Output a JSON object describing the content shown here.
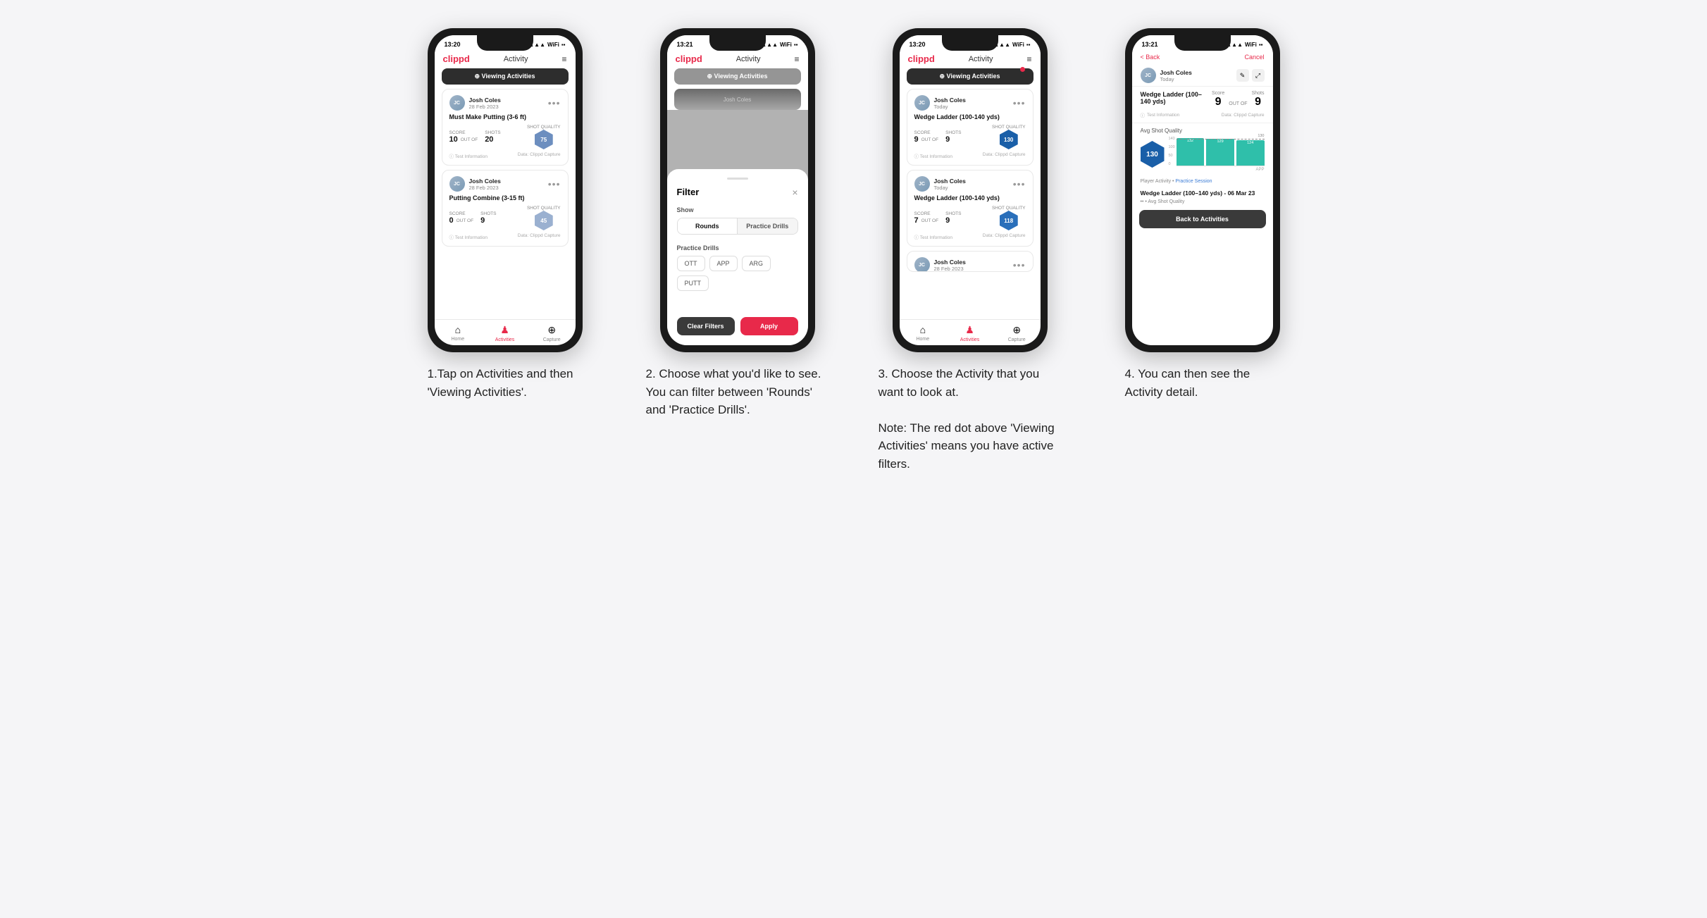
{
  "page": {
    "background": "#f5f5f7"
  },
  "steps": [
    {
      "id": "step1",
      "caption": "1.Tap on Activities and then 'Viewing Activities'.",
      "phone": {
        "statusBar": {
          "time": "13:20",
          "signal": "▲▲▲",
          "wifi": "WiFi",
          "battery": "■■"
        },
        "header": {
          "logo": "clippd",
          "title": "Activity",
          "menuIcon": "≡"
        },
        "viewingBar": {
          "label": "⊕  Viewing Activities",
          "hasRedDot": false
        },
        "cards": [
          {
            "userName": "Josh Coles",
            "userDate": "28 Feb 2023",
            "activityTitle": "Must Make Putting (3-6 ft)",
            "scoreLabel": "Score",
            "shotLabel": "Shots",
            "score": "10",
            "outOf": "OUT OF",
            "shots": "20",
            "qualityLabel": "Shot Quality",
            "quality": "75",
            "qualityClass": "quality-75",
            "footerLeft": "Test Information",
            "footerRight": "Data: Clippd Capture"
          },
          {
            "userName": "Josh Coles",
            "userDate": "28 Feb 2023",
            "activityTitle": "Putting Combine (3-15 ft)",
            "scoreLabel": "Score",
            "shotLabel": "Shots",
            "score": "0",
            "outOf": "OUT OF",
            "shots": "9",
            "qualityLabel": "Shot Quality",
            "quality": "45",
            "qualityClass": "quality-45",
            "footerLeft": "Test Information",
            "footerRight": "Data: Clippd Capture"
          }
        ]
      }
    },
    {
      "id": "step2",
      "caption": "2. Choose what you'd like to see. You can filter between 'Rounds' and 'Practice Drills'.",
      "phone": {
        "statusBar": {
          "time": "13:21",
          "signal": "▲▲▲",
          "wifi": "WiFi",
          "battery": "■■"
        },
        "header": {
          "logo": "clippd",
          "title": "Activity",
          "menuIcon": "≡"
        },
        "viewingBar": {
          "label": "⊕  Viewing Activities",
          "hasRedDot": false
        },
        "filter": {
          "title": "Filter",
          "showLabel": "Show",
          "toggleButtons": [
            {
              "label": "Rounds",
              "active": true
            },
            {
              "label": "Practice Drills",
              "active": false
            }
          ],
          "practiceLabel": "Practice Drills",
          "drillButtons": [
            "OTT",
            "APP",
            "ARG",
            "PUTT"
          ],
          "clearLabel": "Clear Filters",
          "applyLabel": "Apply"
        }
      }
    },
    {
      "id": "step3",
      "caption": "3. Choose the Activity that you want to look at.\n\nNote: The red dot above 'Viewing Activities' means you have active filters.",
      "captionLines": [
        "3. Choose the Activity that you want to look at.",
        "",
        "Note: The red dot above 'Viewing Activities' means you have active filters."
      ],
      "phone": {
        "statusBar": {
          "time": "13:20",
          "signal": "▲▲▲",
          "wifi": "WiFi",
          "battery": "■■"
        },
        "header": {
          "logo": "clippd",
          "title": "Activity",
          "menuIcon": "≡"
        },
        "viewingBar": {
          "label": "⊕  Viewing Activities",
          "hasRedDot": true
        },
        "cards": [
          {
            "userName": "Josh Coles",
            "userDate": "Today",
            "activityTitle": "Wedge Ladder (100-140 yds)",
            "scoreLabel": "Score",
            "shotLabel": "Shots",
            "score": "9",
            "outOf": "OUT OF",
            "shots": "9",
            "qualityLabel": "Shot Quality",
            "quality": "130",
            "qualityClass": "quality-130",
            "footerLeft": "Test Information",
            "footerRight": "Data: Clippd Capture"
          },
          {
            "userName": "Josh Coles",
            "userDate": "Today",
            "activityTitle": "Wedge Ladder (100-140 yds)",
            "scoreLabel": "Score",
            "shotLabel": "Shots",
            "score": "7",
            "outOf": "OUT OF",
            "shots": "9",
            "qualityLabel": "Shot Quality",
            "quality": "118",
            "qualityClass": "quality-118",
            "footerLeft": "Test Information",
            "footerRight": "Data: Clippd Capture"
          },
          {
            "userName": "Josh Coles",
            "userDate": "28 Feb 2023",
            "activityTitle": "",
            "scoreLabel": "",
            "shotLabel": "",
            "score": "",
            "outOf": "",
            "shots": "",
            "qualityLabel": "",
            "quality": "",
            "qualityClass": "",
            "footerLeft": "",
            "footerRight": ""
          }
        ]
      }
    },
    {
      "id": "step4",
      "caption": "4. You can then see the Activity detail.",
      "phone": {
        "statusBar": {
          "time": "13:21",
          "signal": "▲▲▲",
          "wifi": "WiFi",
          "battery": "■■"
        },
        "header": {
          "backLabel": "< Back",
          "cancelLabel": "Cancel"
        },
        "user": {
          "name": "Josh Coles",
          "date": "Today"
        },
        "activityTitle": "Wedge Ladder (100–140 yds)",
        "scoreLabel": "Score",
        "shotsLabel": "Shots",
        "outOfLabel": "OUT OF",
        "score": "9",
        "shots": "9",
        "qualityValue": "130",
        "avgShotQualityLabel": "Avg Shot Quality",
        "chartValues": [
          132,
          129,
          124
        ],
        "chartAxisLabels": [
          "140",
          "100",
          "50",
          "0"
        ],
        "chartXLabel": "APP",
        "practiceSessionLabel": "Player Activity",
        "practiceSessionLink": "Practice Session",
        "drillTitle": "Wedge Ladder (100–140 yds) - 06 Mar 23",
        "avgQualitySubLabel": "•• • Avg Shot Quality",
        "backActivitiesLabel": "Back to Activities",
        "barLabels": [
          "132",
          "129",
          "124"
        ]
      }
    }
  ],
  "icons": {
    "home": "⌂",
    "activities": "♟",
    "capture": "⊕",
    "filter_icon": "⊕",
    "info": "ⓘ",
    "more": "•••",
    "edit": "✎",
    "expand": "⤢",
    "chevron_left": "‹",
    "close": "×"
  }
}
